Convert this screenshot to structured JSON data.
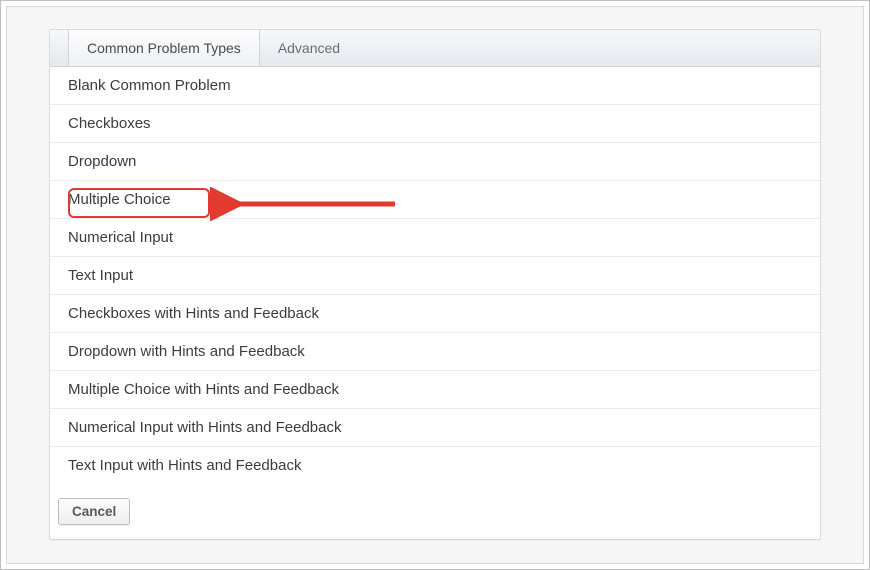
{
  "tabs": {
    "common": "Common Problem Types",
    "advanced": "Advanced"
  },
  "items": [
    "Blank Common Problem",
    "Checkboxes",
    "Dropdown",
    "Multiple Choice",
    "Numerical Input",
    "Text Input",
    "Checkboxes with Hints and Feedback",
    "Dropdown with Hints and Feedback",
    "Multiple Choice with Hints and Feedback",
    "Numerical Input with Hints and Feedback",
    "Text Input with Hints and Feedback"
  ],
  "footer": {
    "cancel": "Cancel"
  },
  "highlighted_item_index": 3,
  "annotation_color": "#e33a2f"
}
